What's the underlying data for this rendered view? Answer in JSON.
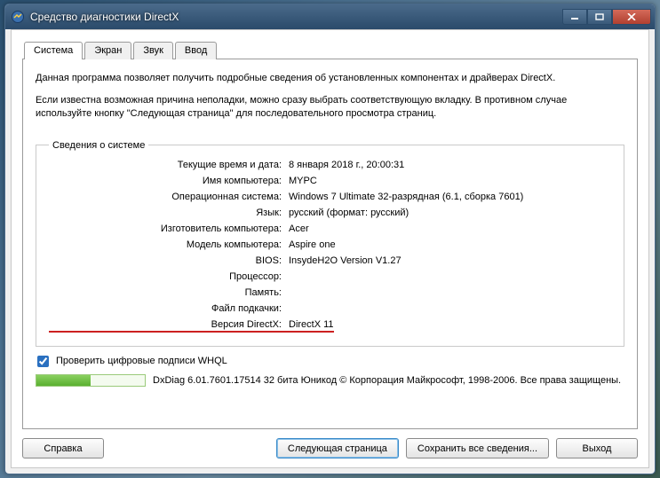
{
  "window": {
    "title": "Средство диагностики DirectX"
  },
  "tabs": [
    "Система",
    "Экран",
    "Звук",
    "Ввод"
  ],
  "activeTab": 0,
  "intro": {
    "p1": "Данная программа позволяет получить подробные сведения об установленных компонентах и драйверах DirectX.",
    "p2": "Если известна возможная причина неполадки, можно сразу выбрать соответствующую вкладку. В противном случае используйте кнопку \"Следующая страница\" для последовательного просмотра страниц."
  },
  "sysinfo": {
    "legend": "Сведения о системе",
    "rows": [
      {
        "label": "Текущие время и дата:",
        "value": "8 января 2018 г., 20:00:31"
      },
      {
        "label": "Имя компьютера:",
        "value": "MYPC"
      },
      {
        "label": "Операционная система:",
        "value": "Windows 7 Ultimate 32-разрядная (6.1, сборка 7601)"
      },
      {
        "label": "Язык:",
        "value": "русский (формат: русский)"
      },
      {
        "label": "Изготовитель компьютера:",
        "value": "Acer"
      },
      {
        "label": "Модель компьютера:",
        "value": "Aspire one"
      },
      {
        "label": "BIOS:",
        "value": "InsydeH2O Version V1.27"
      },
      {
        "label": "Процессор:",
        "value": ""
      },
      {
        "label": "Память:",
        "value": ""
      },
      {
        "label": "Файл подкачки:",
        "value": ""
      },
      {
        "label": "Версия DirectX:",
        "value": "DirectX 11",
        "highlight": true
      }
    ]
  },
  "whql": {
    "label": "Проверить цифровые подписи WHQL",
    "checked": true
  },
  "status": {
    "text": "DxDiag 6.01.7601.17514 32 бита Юникод  © Корпорация Майкрософт, 1998-2006.  Все права защищены."
  },
  "buttons": {
    "help": "Справка",
    "next": "Следующая страница",
    "save": "Сохранить все сведения...",
    "exit": "Выход"
  }
}
